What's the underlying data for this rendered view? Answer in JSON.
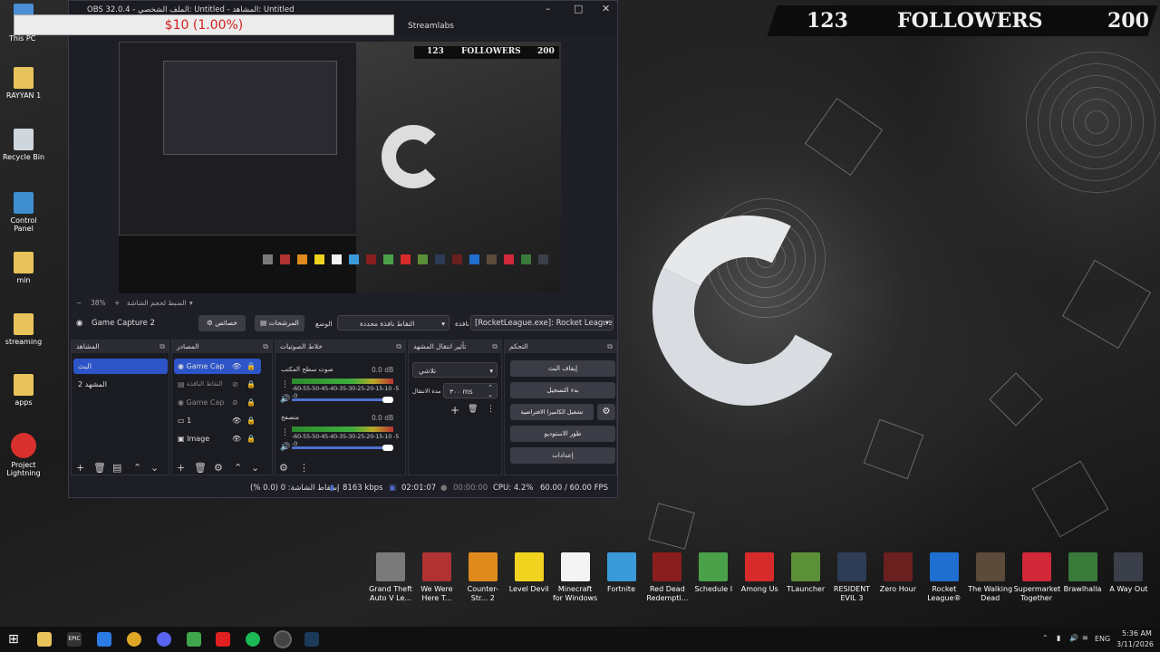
{
  "desktop": {
    "followers_overlay": {
      "left": "123",
      "label": "FOLLOWERS",
      "right": "200"
    },
    "icons": [
      {
        "label": "This PC",
        "icon": "pc-icon"
      },
      {
        "label": "RAYYAN 1",
        "icon": "folder-icon"
      },
      {
        "label": "Recycle Bin",
        "icon": "recycle-bin-icon"
      },
      {
        "label": "Control Panel",
        "icon": "control-panel-icon"
      },
      {
        "label": "min",
        "icon": "folder-icon"
      },
      {
        "label": "streaming",
        "icon": "folder-icon"
      },
      {
        "label": "apps",
        "icon": "folder-icon"
      },
      {
        "label": "Project Lightning",
        "icon": "lightning-app-icon"
      }
    ],
    "games": [
      {
        "label": "Grand Theft Auto V Le...",
        "color": "#7a7a7a"
      },
      {
        "label": "We Were Here T...",
        "color": "#b03232"
      },
      {
        "label": "Counter-Str... 2",
        "color": "#e08a1e"
      },
      {
        "label": "Level Devil",
        "color": "#f1d21f"
      },
      {
        "label": "Minecraft for Windows",
        "color": "#f4f4f4"
      },
      {
        "label": "Fortnite",
        "color": "#3a9ad9"
      },
      {
        "label": "Red Dead Redempti...",
        "color": "#8a1e1e"
      },
      {
        "label": "Schedule I",
        "color": "#4aa14a"
      },
      {
        "label": "Among Us",
        "color": "#d62b2b"
      },
      {
        "label": "TLauncher",
        "color": "#5b8f38"
      },
      {
        "label": "RESIDENT EVIL 3",
        "color": "#2e3c55"
      },
      {
        "label": "Zero Hour",
        "color": "#6b2020"
      },
      {
        "label": "Rocket League®",
        "color": "#1f6fd1"
      },
      {
        "label": "The Walking Dead",
        "color": "#5c4a3a"
      },
      {
        "label": "Supermarket Together",
        "color": "#d1283a"
      },
      {
        "label": "Brawlhalla",
        "color": "#3a7a3a"
      },
      {
        "label": "A Way Out",
        "color": "#3a3f4a"
      }
    ]
  },
  "donation_bar": {
    "text": "$10 (1.00%)"
  },
  "obs": {
    "title": "OBS 32.0.4 - الملف الشخصي: Untitled - المشاهد: Untitled",
    "menu_streamlabs": "Streamlabs",
    "zoom": "38%",
    "preview_hint": "الضبط لحجم الشاشة",
    "preview_followers": {
      "left": "123",
      "label": "FOLLOWERS",
      "right": "200"
    },
    "source_bar": {
      "source_name": "Game Capture 2",
      "properties": "خصائص",
      "filters": "المرشحات",
      "mode_label": "الوضع",
      "mode_value": "التقاط نافذة محددة",
      "window_label": "نافذة",
      "window_value": "[RocketLeague.exe]: Rocket League"
    },
    "scenes": {
      "title": "المشاهد",
      "items": [
        "البث",
        "المشهد 2"
      ]
    },
    "sources": {
      "title": "المصادر",
      "items": [
        "Game Capture 2",
        "التقاط النافذة",
        "Game Capture",
        "1",
        "Image"
      ]
    },
    "mixer": {
      "title": "خلاط الصوتيات",
      "channels": [
        {
          "name": "صوت سطح المكتب",
          "db": "0.0 dB",
          "scale": "-60-55-50-45-40-35-30-25-20-15-10 -5 -0"
        },
        {
          "name": "متصفح",
          "db": "0.0 dB",
          "scale": "-60-55-50-45-40-35-30-25-20-15-10 -5 -0"
        }
      ]
    },
    "transitions": {
      "title": "تأثير انتقال المشهد",
      "type": "تلاشي",
      "duration_label": "مدة الانتقال",
      "duration": "٣٠٠ ms"
    },
    "controls": {
      "title": "التحكم",
      "buttons": [
        "إيقاف البث",
        "بدء التسجيل",
        "تشغيل الكاميرا الافتراضية",
        "طور الاستوديو",
        "إعدادات"
      ]
    },
    "status": {
      "dropped": "إسقاط الشاشة: 0 (0.0 %)",
      "bitrate": "8163 kbps",
      "stream_time": "02:01:07",
      "rec_time": "00:00:00",
      "cpu": "CPU: 4.2%",
      "fps": "60.00 / 60.00 FPS"
    }
  },
  "taskbar": {
    "lang": "ENG",
    "time": "5:36 AM",
    "date": "3/11/2026"
  }
}
